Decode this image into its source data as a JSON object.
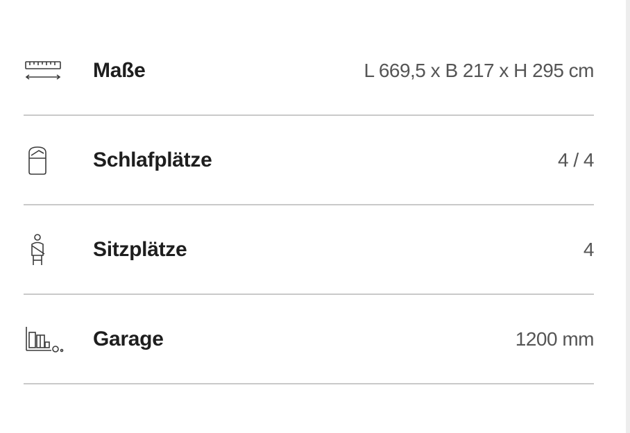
{
  "specs": [
    {
      "icon": "ruler-dimensions-icon",
      "label": "Maße",
      "value": "L 669,5 x B 217 x H 295 cm"
    },
    {
      "icon": "sleeping-bag-icon",
      "label": "Schlafplätze",
      "value": "4 / 4"
    },
    {
      "icon": "seatbelt-icon",
      "label": "Sitzplätze",
      "value": "4"
    },
    {
      "icon": "garage-storage-icon",
      "label": "Garage",
      "value": "1200 mm"
    }
  ]
}
